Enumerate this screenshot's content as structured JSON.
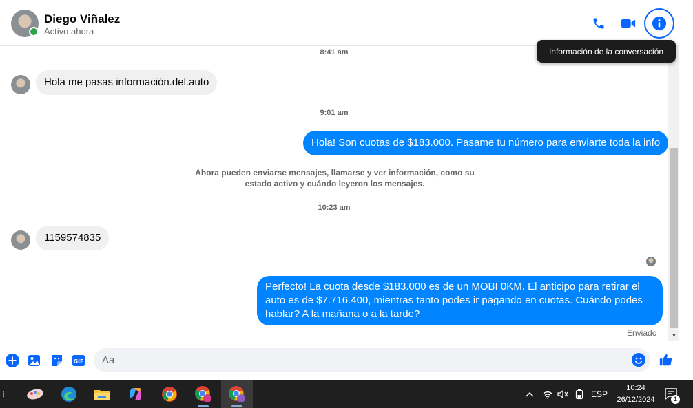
{
  "header": {
    "contact_name": "Diego Viñalez",
    "contact_status": "Activo ahora",
    "tooltip": "Información de la conversación",
    "icons": [
      "phone-icon",
      "video-camera-icon",
      "info-icon"
    ]
  },
  "conversation": {
    "timestamps": [
      "8:41 am",
      "9:01 am",
      "10:23 am"
    ],
    "messages": [
      {
        "from": "them",
        "text": "Hola me pasas información.del.auto"
      },
      {
        "from": "me",
        "text": "Hola! Son cuotas de $183.000. Pasame tu número para enviarte toda la info"
      },
      {
        "from": "them",
        "text": "1159574835"
      },
      {
        "from": "me",
        "text": "Perfecto! La cuota desde $183.000 es de un MOBI 0KM. El anticipo para retirar el auto es de $7.716.400, mientras tanto podes ir pagando en cuotas. Cuándo podes hablar? A la mañana o a la tarde?"
      }
    ],
    "system_note": "Ahora pueden enviarse mensajes, llamarse y ver información, como su estado activo y cuándo leyeron los mensajes.",
    "sent_status": "Enviado"
  },
  "composer": {
    "placeholder": "Aa",
    "icons": [
      "plus-icon",
      "photo-icon",
      "sticker-icon",
      "gif-icon",
      "emoji-icon",
      "thumbs-up-icon"
    ]
  },
  "taskbar": {
    "language": "ESP",
    "time": "10:24",
    "date": "26/12/2024",
    "notification_count": "1"
  },
  "colors": {
    "accent": "#0866ff",
    "outgoing_bubble": "#0084ff",
    "incoming_bubble": "#f0f0f0",
    "online": "#31a24c",
    "taskbar": "#1f1f1f"
  }
}
